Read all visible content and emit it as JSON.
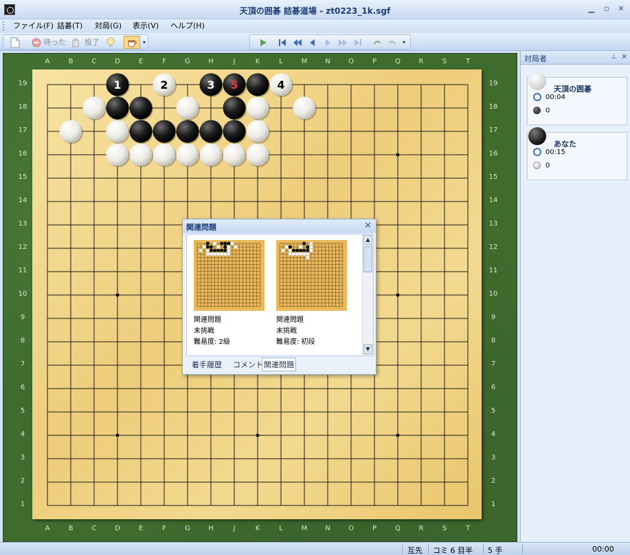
{
  "window": {
    "title": "天頂の囲碁 詰碁道場 - zt0223_1k.sgf"
  },
  "menu": [
    "ファイル(F)",
    "詰碁(T)",
    "対局(G)",
    "表示(V)",
    "ヘルプ(H)"
  ],
  "toolbar": {
    "wait_label": "待った",
    "resign_label": "投了"
  },
  "board": {
    "size": 19,
    "columns": [
      "A",
      "B",
      "C",
      "D",
      "E",
      "F",
      "G",
      "H",
      "J",
      "K",
      "L",
      "M",
      "N",
      "O",
      "P",
      "Q",
      "R",
      "S",
      "T"
    ],
    "stones": {
      "black": [
        "D19",
        "H19",
        "J19",
        "K19",
        "D18",
        "E18",
        "J18",
        "E17",
        "F17",
        "G17",
        "H17",
        "J17"
      ],
      "white": [
        "F19",
        "L19",
        "C18",
        "G18",
        "K18",
        "M18",
        "B17",
        "D17",
        "K17",
        "D16",
        "E16",
        "F16",
        "G16",
        "H16",
        "J16",
        "K16"
      ]
    },
    "move_numbers": [
      {
        "point": "D19",
        "number": "1",
        "color": "black"
      },
      {
        "point": "F19",
        "number": "2",
        "color": "white"
      },
      {
        "point": "H19",
        "number": "3",
        "color": "black"
      },
      {
        "point": "J19",
        "number": "5",
        "color": "black",
        "last": true
      },
      {
        "point": "L19",
        "number": "4",
        "color": "white"
      }
    ],
    "hoshi": [
      "D16",
      "K16",
      "Q16",
      "D10",
      "K10",
      "Q10",
      "D4",
      "K4",
      "Q4"
    ],
    "colors": {
      "last_move": "#e8383d",
      "board": "#f0d088",
      "frame": "#3f6b2f"
    }
  },
  "side_panel": {
    "header": "対局者",
    "players": [
      {
        "name": "天頂の囲碁",
        "stone": "white",
        "time": "00:04",
        "captures": "0"
      },
      {
        "name": "あなた",
        "stone": "black",
        "time": "00:15",
        "captures": "0"
      }
    ]
  },
  "popup": {
    "title": "関連問題",
    "items": [
      {
        "label": "関連問題",
        "status": "未挑戦",
        "difficulty": "難易度: 2級"
      },
      {
        "label": "関連問題",
        "status": "未挑戦",
        "difficulty": "難易度: 初段"
      }
    ],
    "tabs": [
      "着手履歴",
      "コメント",
      "関連問題"
    ],
    "active_tab": "関連問題"
  },
  "statusbar": {
    "handicap": "互先",
    "komi": "コミ 6 目半",
    "move": "5 手",
    "time": "00:00"
  }
}
